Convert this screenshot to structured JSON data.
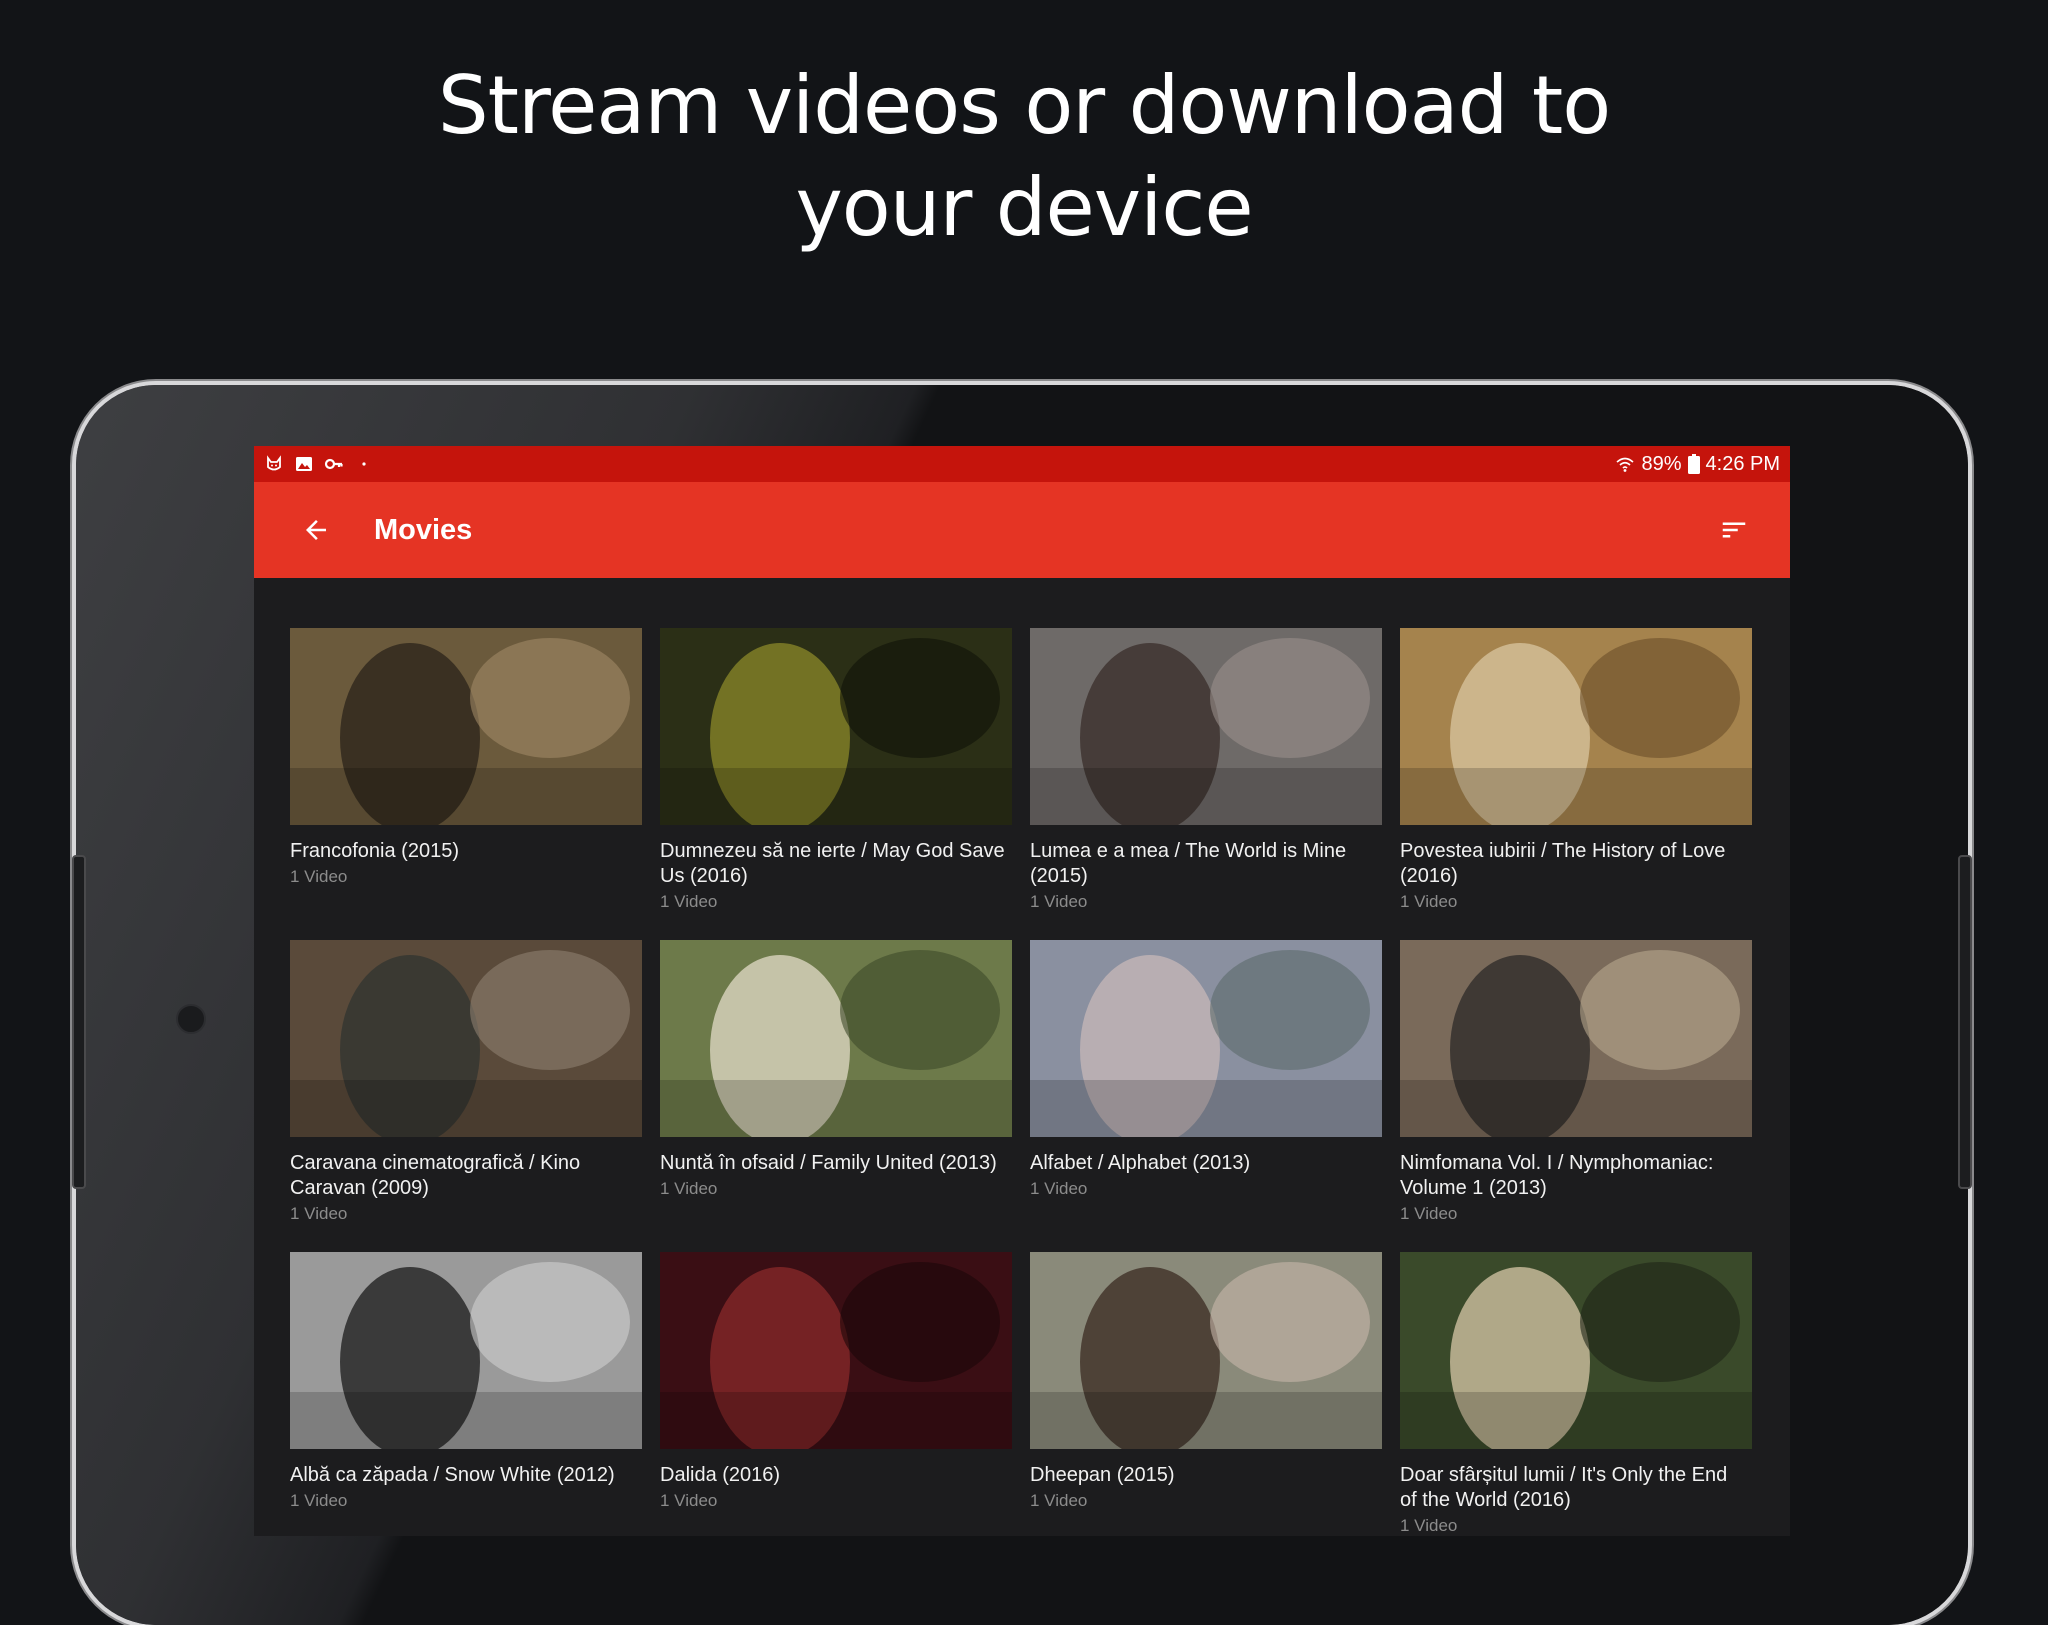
{
  "headline": {
    "line1": "Stream videos or download to",
    "line2": "your device"
  },
  "status_bar": {
    "left_icons": [
      "cat-icon",
      "image-icon",
      "key-icon",
      "dot-icon"
    ],
    "battery": "89%",
    "time": "4:26 PM"
  },
  "app_bar": {
    "title": "Movies",
    "back_icon": "arrow-back-icon",
    "sort_icon": "sort-icon"
  },
  "movies": [
    {
      "title": "Francofonia (2015)",
      "count": "1 Video",
      "colors": [
        "#6b5a3c",
        "#2a231a",
        "#a08866"
      ]
    },
    {
      "title": "Dumnezeu să ne ierte / May God Save Us (2016)",
      "count": "1 Video",
      "colors": [
        "#2b2f16",
        "#8c8a2a",
        "#0f1208"
      ]
    },
    {
      "title": "Lumea e a mea / The World is Mine (2015)",
      "count": "1 Video",
      "colors": [
        "#6e6a68",
        "#3a2e2a",
        "#9a8f8c"
      ]
    },
    {
      "title": "Povestea iubirii / The History of Love (2016)",
      "count": "1 Video",
      "colors": [
        "#a5834d",
        "#d9c6a0",
        "#6a4e2a"
      ]
    },
    {
      "title": "Caravana cinematografică / Kino Caravan (2009)",
      "count": "1 Video",
      "colors": [
        "#5a4a3a",
        "#303430",
        "#8e8070"
      ]
    },
    {
      "title": "Nuntă în ofsaid / Family United (2013)",
      "count": "1 Video",
      "colors": [
        "#6d7a4a",
        "#e3dcc8",
        "#3d4a2a"
      ]
    },
    {
      "title": "Alfabet / Alphabet (2013)",
      "count": "1 Video",
      "colors": [
        "#8a90a0",
        "#c7b8b8",
        "#5b6a6a"
      ]
    },
    {
      "title": "Nimfomana Vol. I / Nymphomaniac: Volume 1 (2013)",
      "count": "1 Video",
      "colors": [
        "#7a6a5a",
        "#2c2a28",
        "#b8a88e"
      ]
    },
    {
      "title": "Albă ca zăpada / Snow White (2012)",
      "count": "1 Video",
      "colors": [
        "#9a9a9a",
        "#1a1a1a",
        "#d0d0d0"
      ]
    },
    {
      "title": "Dalida (2016)",
      "count": "1 Video",
      "colors": [
        "#3a0e14",
        "#8a2a2a",
        "#1a0608"
      ]
    },
    {
      "title": "Dheepan (2015)",
      "count": "1 Video",
      "colors": [
        "#8a8a7a",
        "#3a2a22",
        "#c8b8aa"
      ]
    },
    {
      "title": "Doar sfârșitul lumii / It's Only the End of the World (2016)",
      "count": "1 Video",
      "colors": [
        "#3a4a2a",
        "#d8c8a8",
        "#1e2418"
      ]
    }
  ],
  "colors": {
    "status_bar": "#c5140c",
    "app_bar": "#e53424",
    "screen_bg": "#1c1c1e",
    "page_bg": "#121417"
  }
}
